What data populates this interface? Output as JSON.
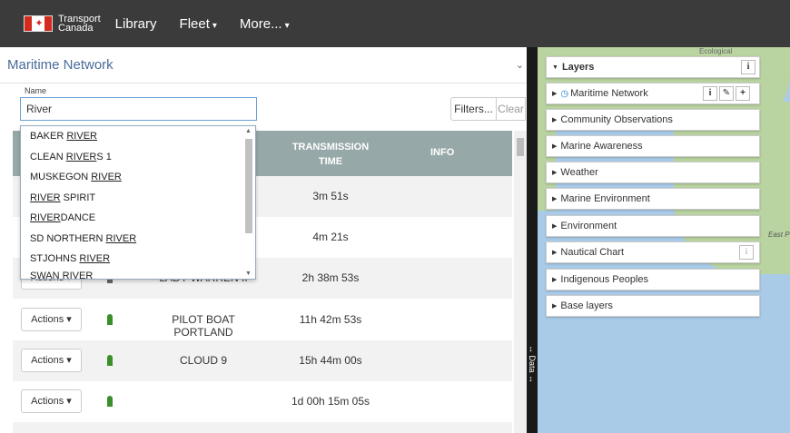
{
  "nav": {
    "brand_line1": "Transport",
    "brand_line2": "Canada",
    "library": "Library",
    "fleet": "Fleet",
    "more": "More..."
  },
  "panel": {
    "title": "Maritime Network",
    "name_label": "Name",
    "name_value": "River",
    "filters": "Filters...",
    "clear": "Clear"
  },
  "table": {
    "col_transmission_line1": "TRANSMISSION",
    "col_transmission_line2": "TIME",
    "col_info": "INFO",
    "actions_label": "Actions",
    "rows": [
      {
        "name": "",
        "time": "3m 51s"
      },
      {
        "name": "",
        "time": "4m 21s"
      },
      {
        "name": "LADY WARREN II",
        "time": "2h 38m 53s"
      },
      {
        "name": "PILOT BOAT PORTLAND",
        "time": "11h 42m 53s"
      },
      {
        "name": "CLOUD 9",
        "time": "15h 44m 00s"
      },
      {
        "name": "",
        "time": "1d 00h 15m 05s"
      }
    ]
  },
  "autocomplete": [
    {
      "pre": "BAKER ",
      "match": "RIVER",
      "post": ""
    },
    {
      "pre": "CLEAN ",
      "match": "RIVER",
      "post": "S 1"
    },
    {
      "pre": "MUSKEGON ",
      "match": "RIVER",
      "post": ""
    },
    {
      "pre": "",
      "match": "RIVER",
      "post": " SPIRIT"
    },
    {
      "pre": "",
      "match": "RIVER",
      "post": "DANCE"
    },
    {
      "pre": "SD NORTHERN ",
      "match": "RIVER",
      "post": ""
    },
    {
      "pre": "STJOHNS ",
      "match": "RIVER",
      "post": ""
    },
    {
      "pre": "SWAN RIVER",
      "match": "",
      "post": ""
    }
  ],
  "divider_label": "Data",
  "layers": {
    "header": "Layers",
    "items": [
      "Maritime Network",
      "Community Observations",
      "Marine Awareness",
      "Weather",
      "Marine Environment",
      "Environment",
      "Nautical Chart",
      "Indigenous Peoples",
      "Base layers"
    ]
  },
  "map_labels": {
    "top": "Ecological",
    "right": "East P"
  },
  "colors": {
    "topbar": "#3b3b3b",
    "table_header": "#96a9a8",
    "title_blue": "#4a6b9a",
    "vessel_green": "#3a8f2a",
    "map_water": "#a9cbe8"
  }
}
